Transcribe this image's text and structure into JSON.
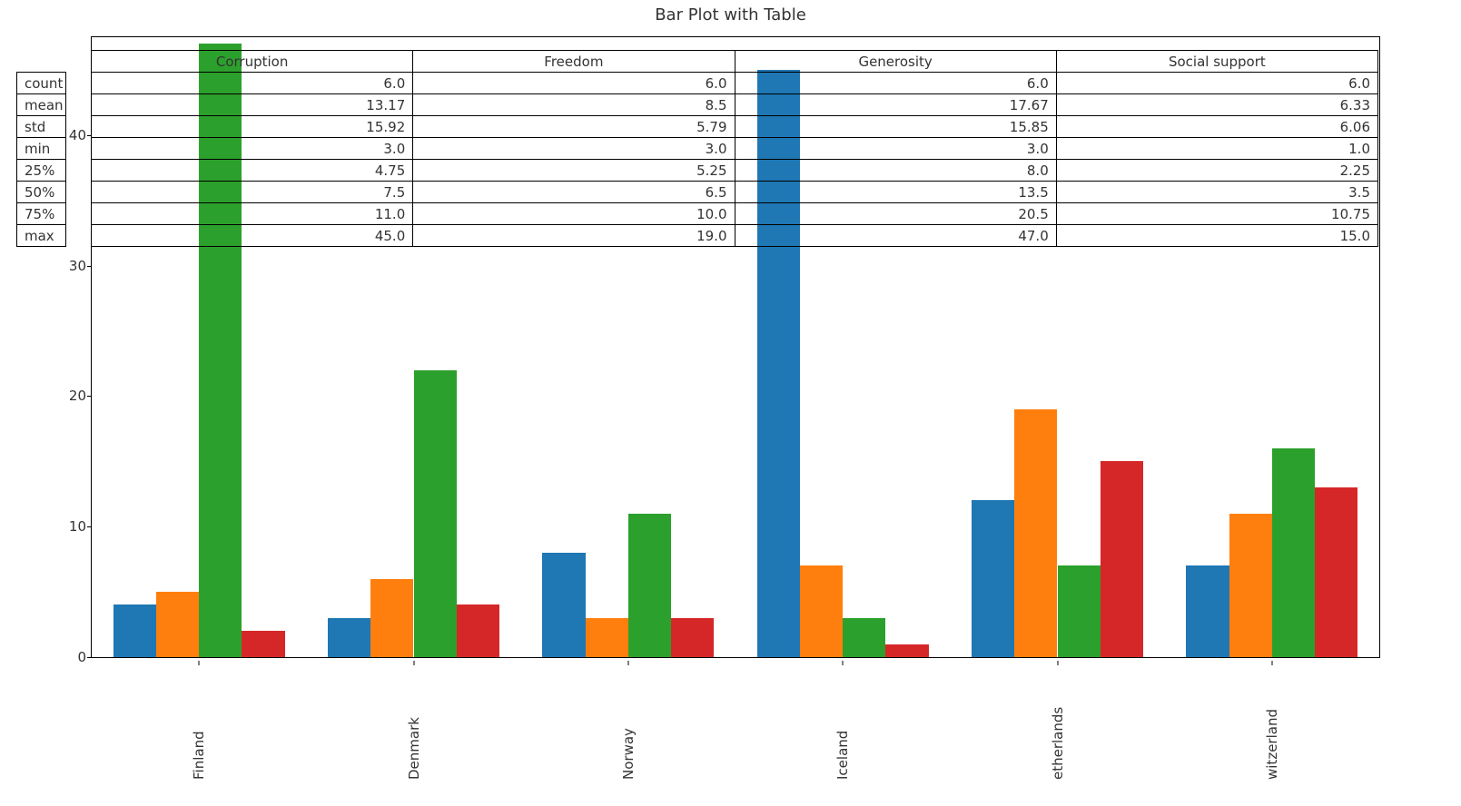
{
  "title": "Bar Plot with Table",
  "yticks": [
    0,
    10,
    20,
    30,
    40
  ],
  "ymax": 47.5,
  "colors": {
    "corruption": "#1f77b4",
    "freedom": "#ff7f0e",
    "generosity": "#2ca02c",
    "social_support": "#d62728"
  },
  "table": {
    "columns": [
      "Corruption",
      "Freedom",
      "Generosity",
      "Social support"
    ],
    "rows": [
      {
        "label": "count",
        "values": [
          "6.0",
          "6.0",
          "6.0",
          "6.0"
        ]
      },
      {
        "label": "mean",
        "values": [
          "13.17",
          "8.5",
          "17.67",
          "6.33"
        ]
      },
      {
        "label": "std",
        "values": [
          "15.92",
          "5.79",
          "15.85",
          "6.06"
        ]
      },
      {
        "label": "min",
        "values": [
          "3.0",
          "3.0",
          "3.0",
          "1.0"
        ]
      },
      {
        "label": "25%",
        "values": [
          "4.75",
          "5.25",
          "8.0",
          "2.25"
        ]
      },
      {
        "label": "50%",
        "values": [
          "7.5",
          "6.5",
          "13.5",
          "3.5"
        ]
      },
      {
        "label": "75%",
        "values": [
          "11.0",
          "10.0",
          "20.5",
          "10.75"
        ]
      },
      {
        "label": "max",
        "values": [
          "45.0",
          "19.0",
          "47.0",
          "15.0"
        ]
      }
    ]
  },
  "chart_data": {
    "type": "bar",
    "title": "Bar Plot with Table",
    "xlabel": "",
    "ylabel": "",
    "ylim": [
      0,
      47.5
    ],
    "categories": [
      "Finland",
      "Denmark",
      "Norway",
      "Iceland",
      "Netherlands",
      "Switzerland"
    ],
    "series": [
      {
        "name": "Corruption",
        "color": "#1f77b4",
        "values": [
          4,
          3,
          8,
          45,
          12,
          7
        ]
      },
      {
        "name": "Freedom",
        "color": "#ff7f0e",
        "values": [
          5,
          6,
          3,
          7,
          19,
          11
        ]
      },
      {
        "name": "Generosity",
        "color": "#2ca02c",
        "values": [
          47,
          22,
          11,
          3,
          7,
          16
        ]
      },
      {
        "name": "Social support",
        "color": "#d62728",
        "values": [
          2,
          4,
          3,
          1,
          15,
          13
        ]
      }
    ],
    "xtick_display": [
      "Finland",
      "Denmark",
      "Norway",
      "Iceland",
      "etherlands",
      "witzerland"
    ]
  }
}
